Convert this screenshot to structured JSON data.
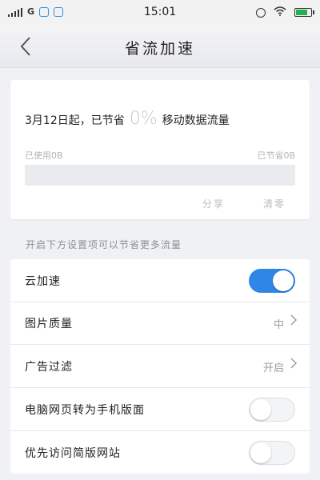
{
  "status_bar": {
    "network": "G",
    "time": "15:01"
  },
  "header": {
    "title": "省流加速"
  },
  "summary": {
    "date_prefix": "3月12日起，已节省",
    "percent": "0%",
    "suffix": "移动数据流量",
    "used_label": "已使用0B",
    "saved_label": "已节省0B",
    "progress": 0,
    "share_label": "分享",
    "clear_label": "清零"
  },
  "hint": "开启下方设置项可以节省更多流量",
  "settings": {
    "cloud_accel": {
      "label": "云加速",
      "enabled": true
    },
    "image_quality": {
      "label": "图片质量",
      "value": "中"
    },
    "ad_filter": {
      "label": "广告过滤",
      "value": "开启"
    },
    "mobile_view": {
      "label": "电脑网页转为手机版面",
      "enabled": false
    },
    "simple_sites": {
      "label": "优先访问简版网站",
      "enabled": false
    }
  },
  "colors": {
    "accent": "#2f86e6"
  }
}
